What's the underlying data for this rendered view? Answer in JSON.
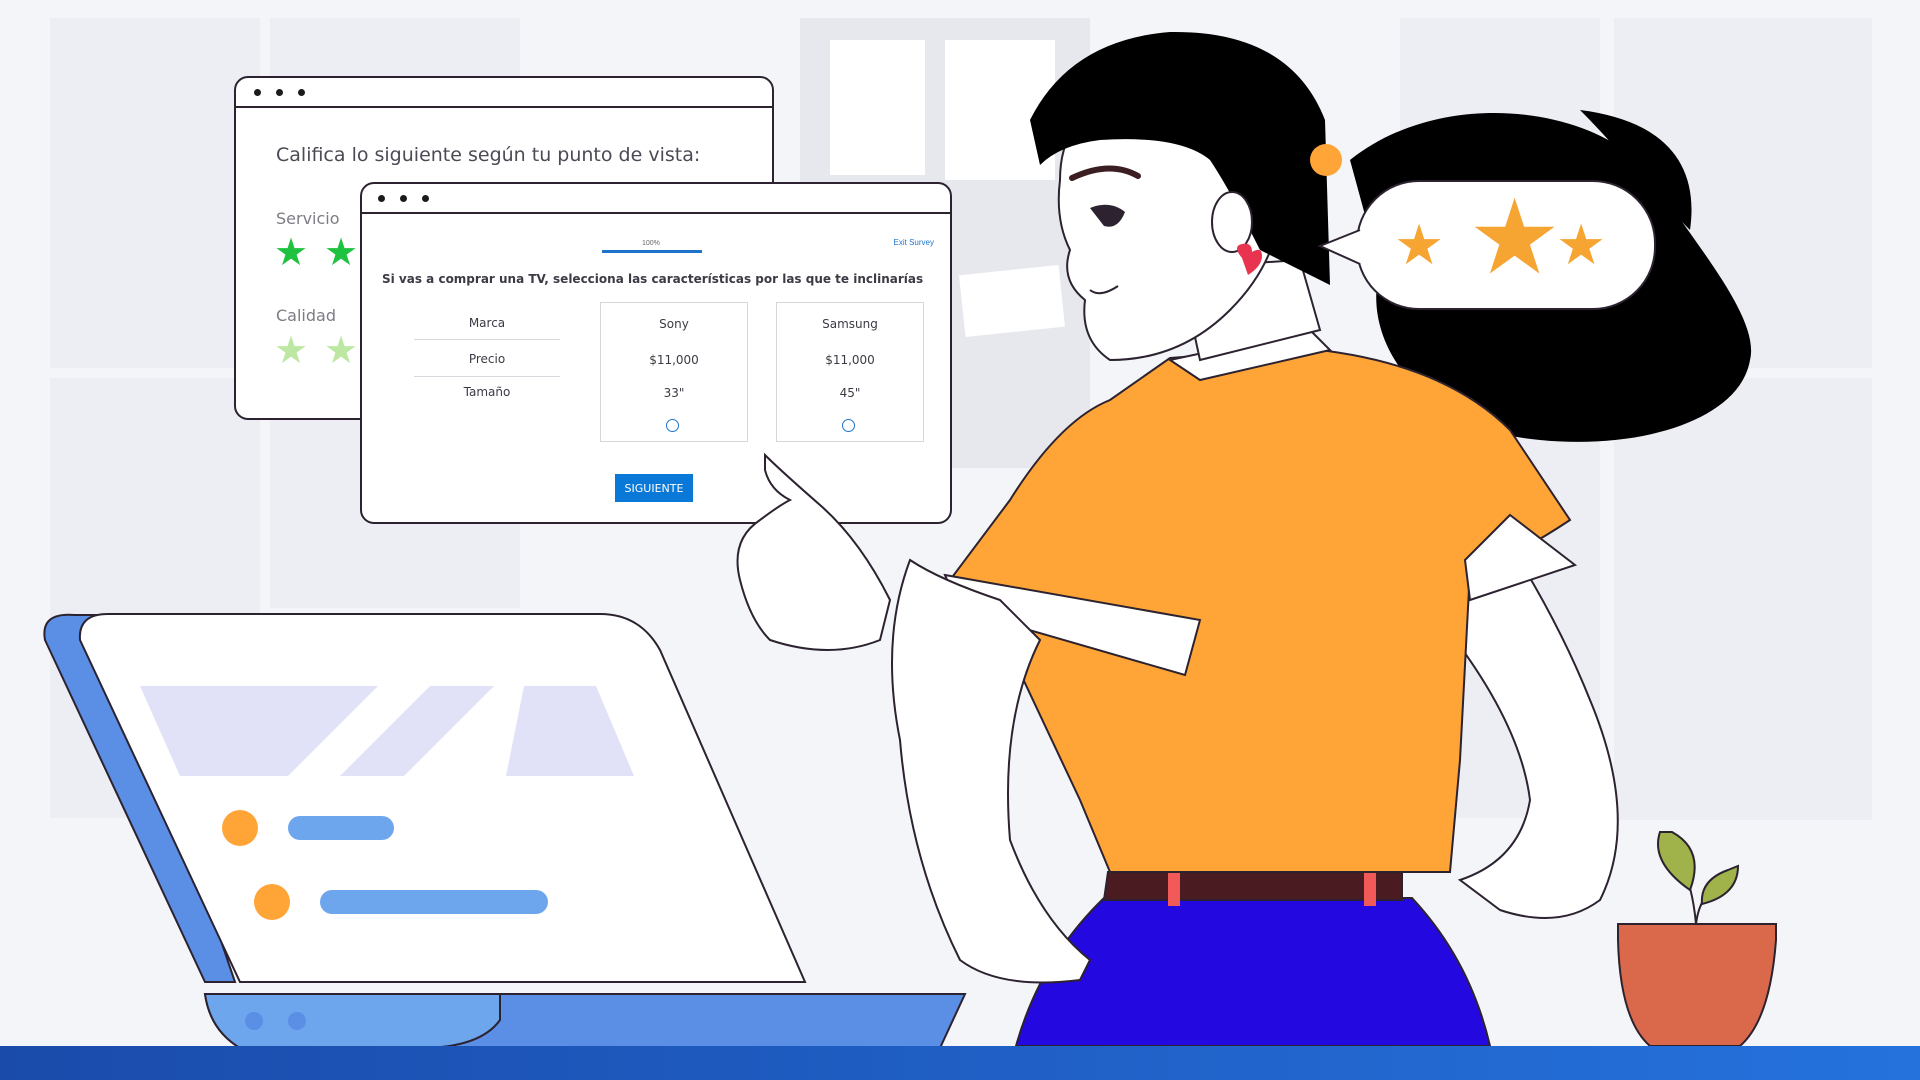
{
  "back_window": {
    "title": "Califica lo siguiente según tu punto de vista:",
    "items": [
      {
        "label": "Servicio"
      },
      {
        "label": "Calidad"
      }
    ]
  },
  "front_window": {
    "progress_label": "100%",
    "progress": 1.0,
    "exit_label": "Exit Survey",
    "question": "Si vas a comprar una TV, selecciona las características por las que te inclinarías",
    "rows": [
      "Marca",
      "Precio",
      "Tamaño"
    ],
    "options": [
      {
        "brand": "Sony",
        "price": "$11,000",
        "size": "33\""
      },
      {
        "brand": "Samsung",
        "price": "$11,000",
        "size": "45\""
      }
    ],
    "next_label": "SIGUIENTE"
  },
  "speech_bubble": {
    "stars": 3
  },
  "colors": {
    "accent_blue": "#0a78d7",
    "star_green": "#1ec23f",
    "star_light_green": "#bde8a4",
    "shirt_orange": "#ffa436",
    "skirt_blue": "#2408e0",
    "laptop_blue": "#5b8fe6",
    "pot_orange": "#d9694a"
  },
  "icons": [
    "star-icon",
    "radio-icon",
    "window-dots-icon"
  ]
}
